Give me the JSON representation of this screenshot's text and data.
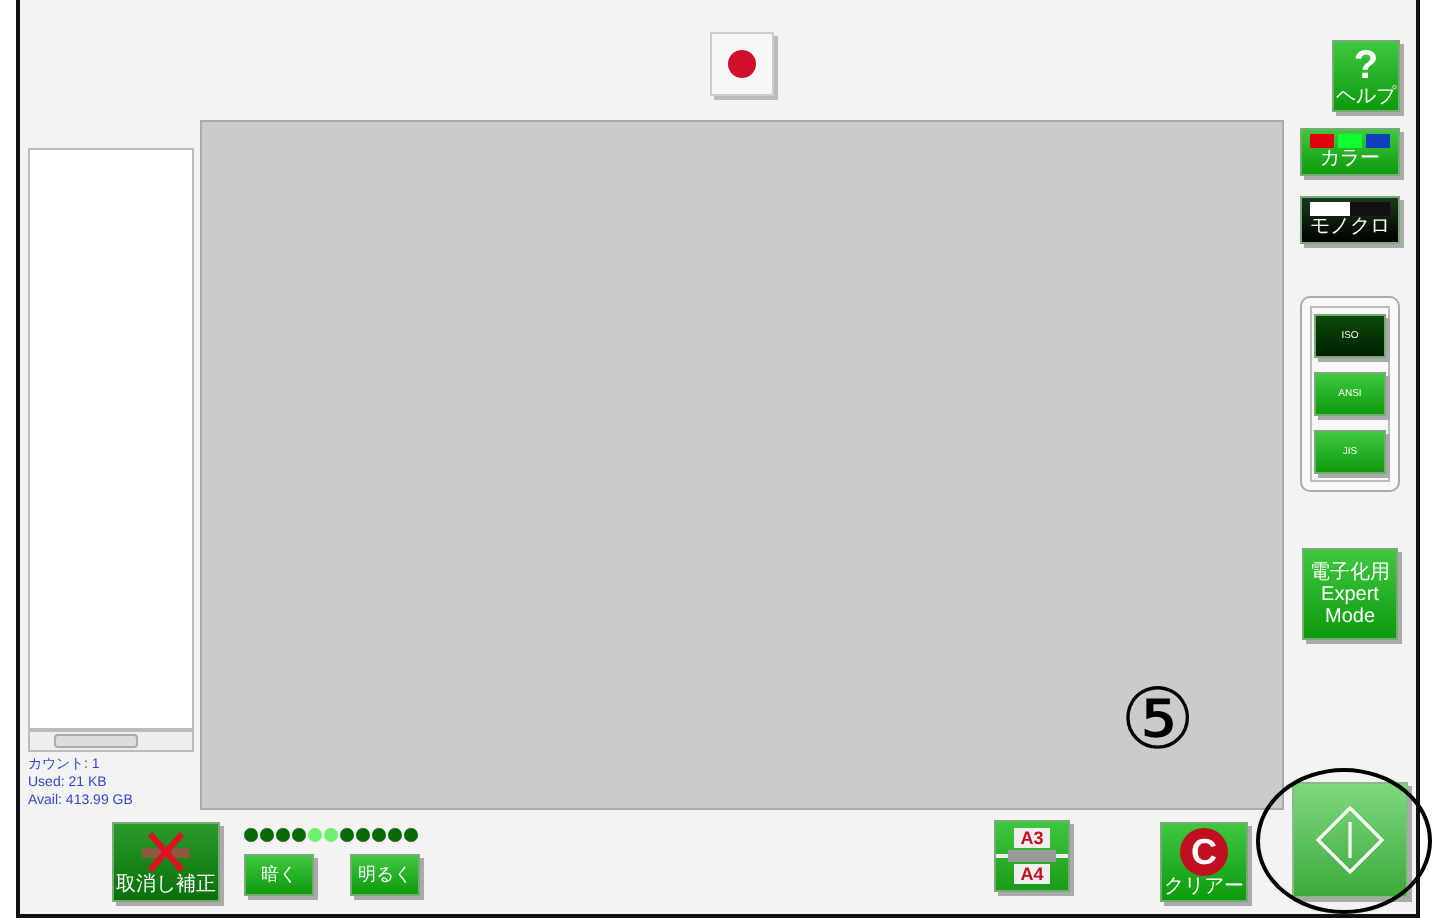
{
  "file_panel": {
    "stats": [
      "カウント: 1",
      "Used: 21 KB",
      "Avail: 413.99 GB"
    ]
  },
  "side_buttons": [
    {
      "kind": "help",
      "symbol": "?",
      "label": "ヘルプ"
    },
    {
      "kind": "color",
      "label": "カラー"
    },
    {
      "kind": "mono",
      "label": "モノクロ"
    }
  ],
  "paper_standards": [
    {
      "label": "ISO",
      "selected": true
    },
    {
      "label": "ANSI",
      "selected": false
    },
    {
      "label": "JIS",
      "selected": false
    }
  ],
  "expert_mode": {
    "lines": [
      "電子化用",
      "Expert",
      "Mode"
    ]
  },
  "bottom_bar": {
    "undo_label": "取消し補正",
    "brightness_dots": [
      {
        "on": false
      },
      {
        "on": false
      },
      {
        "on": false
      },
      {
        "on": false
      },
      {
        "on": true
      },
      {
        "on": true
      },
      {
        "on": false
      },
      {
        "on": false
      },
      {
        "on": false
      },
      {
        "on": false
      },
      {
        "on": false
      }
    ],
    "darker": "暗く",
    "brighter": "明るく",
    "paper_sizes": [
      "A3",
      "A4"
    ],
    "clear_symbol": "C",
    "clear_label": "クリアー"
  },
  "annotation": {
    "label": "⑤"
  }
}
